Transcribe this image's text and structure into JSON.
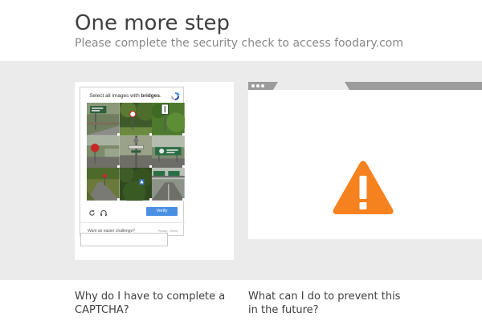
{
  "page": {
    "title": "One more step",
    "subtitle": "Please complete the security check to access foodary.com"
  },
  "captcha": {
    "prompt_prefix": "Select all images with",
    "prompt_target": "bridges",
    "prompt_suffix": ".",
    "verify_label": "Verify",
    "easier_link": "Want an easier challenge?",
    "privacy_terms": "Privacy - Terms",
    "response_value": "",
    "tiles": [
      "road-sign-tile",
      "tree-road-sign-tile",
      "trees-sign-tile",
      "stop-sign-tile",
      "pole-street-sign-tile",
      "highway-sign-tile",
      "road-grass-tile",
      "forest-tile",
      "highway-overpass-tile"
    ],
    "icons": {
      "reload": "reload-icon",
      "audio": "headphones-icon",
      "logo": "recaptcha-logo-icon"
    }
  },
  "browser_illustration": {
    "icon": "warning-icon",
    "warning_color": "#f6821f"
  },
  "faq": {
    "q1": "Why do I have to complete a CAPTCHA?",
    "q2": "What can I do to prevent this in the future?"
  },
  "colors": {
    "band": "#ebebeb",
    "verify": "#4a90e2",
    "browser_bar": "#9c9c9c"
  }
}
